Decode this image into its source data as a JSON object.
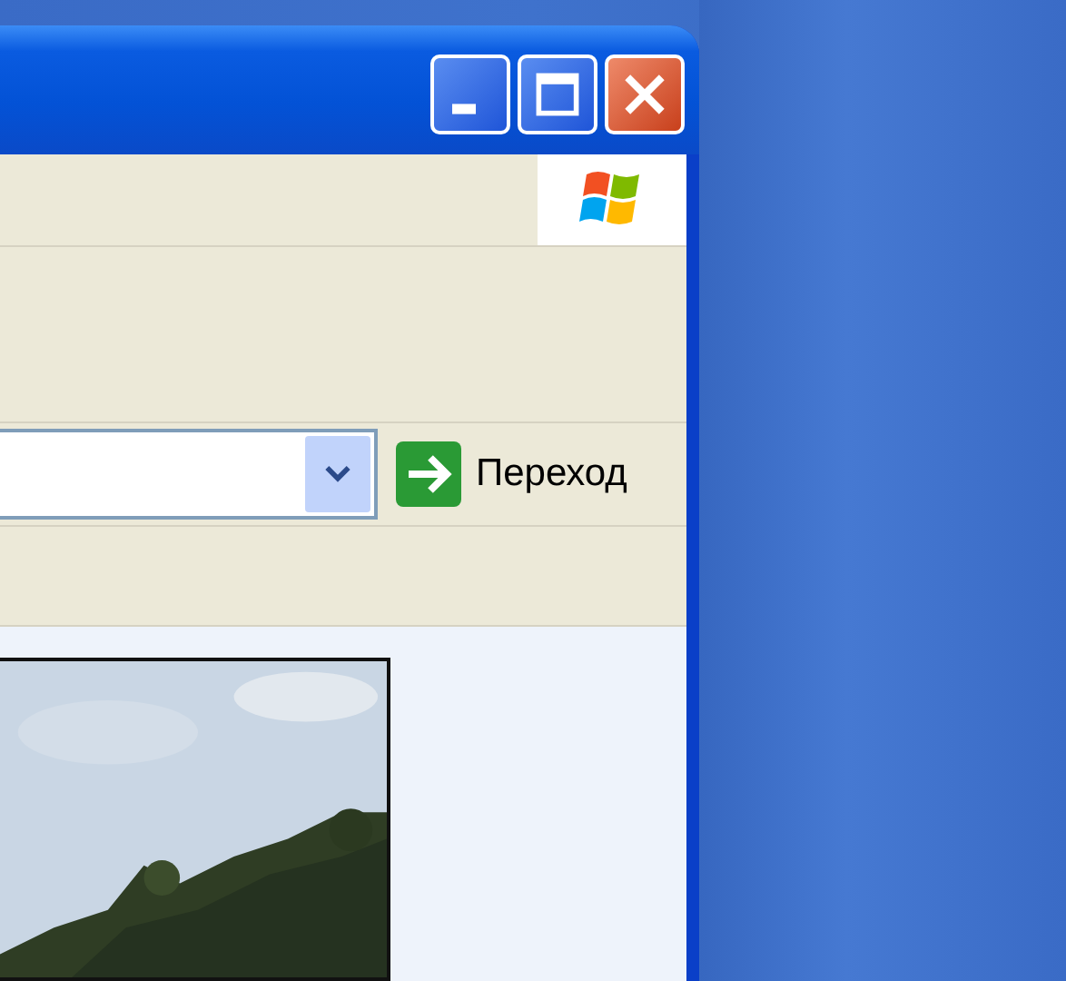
{
  "address_bar": {
    "go_button": "Переход"
  }
}
